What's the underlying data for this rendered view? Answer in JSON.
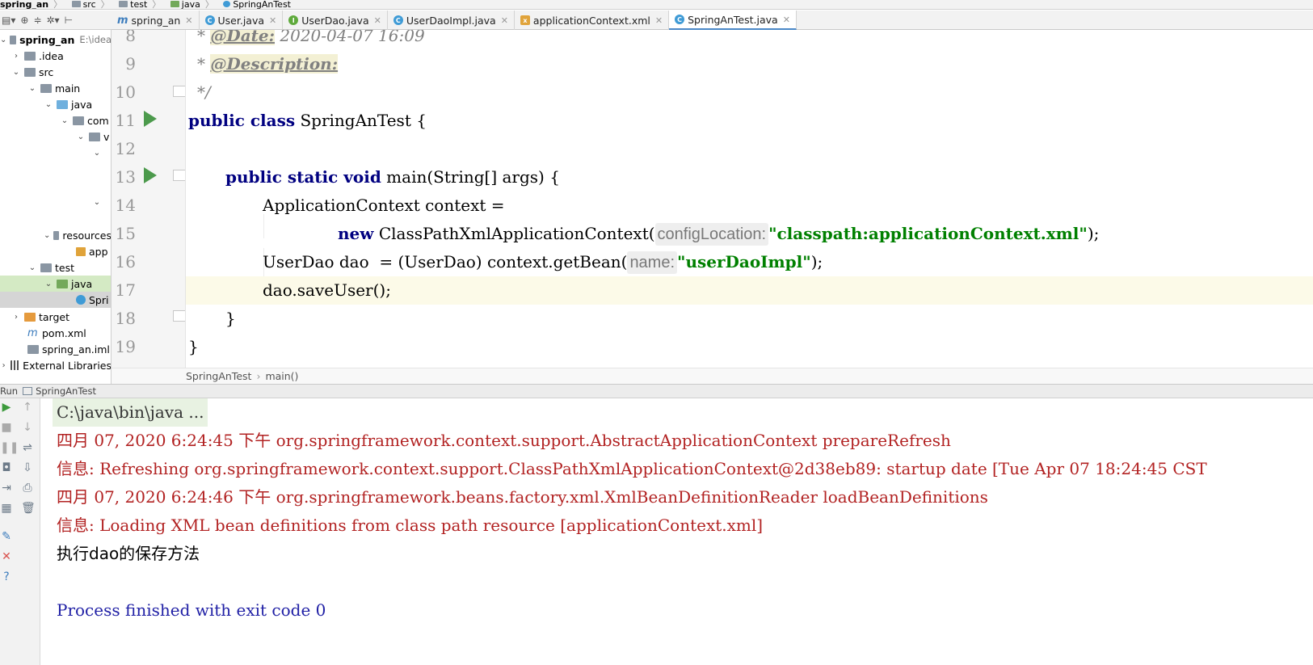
{
  "breadcrumb": [
    "spring_an",
    "src",
    "test",
    "java",
    "SpringAnTest"
  ],
  "tabs": [
    {
      "label": "spring_an",
      "icon": "m"
    },
    {
      "label": "User.java",
      "icon": "c"
    },
    {
      "label": "UserDao.java",
      "icon": "i"
    },
    {
      "label": "UserDaoImpl.java",
      "icon": "c"
    },
    {
      "label": "applicationContext.xml",
      "icon": "x"
    },
    {
      "label": "SpringAnTest.java",
      "icon": "c",
      "active": true
    }
  ],
  "tree": {
    "project": "spring_an",
    "project_path": "E:\\idea",
    "idea": ".idea",
    "src": "src",
    "main": "main",
    "java": "java",
    "com": "com",
    "v": "v",
    "resources": "resources",
    "app": "app",
    "test": "test",
    "test_java": "java",
    "spri": "Spri",
    "target": "target",
    "pom": "pom.xml",
    "iml": "spring_an.iml",
    "libs": "External Libraries"
  },
  "code": {
    "line_numbers": [
      "8",
      "9",
      "10",
      "11",
      "12",
      "13",
      "14",
      "15",
      "16",
      "17",
      "18",
      "19"
    ],
    "l8_prefix": "* ",
    "l8_tag": "@Date:",
    "l8_rest": " 2020-04-07 16:09",
    "l9_prefix": "* ",
    "l9_tag": "@Description:",
    "l10": "*/",
    "l11_kw": "public class",
    "l11_rest": " SpringAnTest {",
    "l13_kw": "public static void",
    "l13_rest": " main(String[] args) {",
    "l14": "ApplicationContext context =",
    "l15_kw": "new",
    "l15_call": " ClassPathXmlApplicationContext(",
    "l15_hint": "configLocation:",
    "l15_str": "\"classpath:applicationContext.xml\"",
    "l15_end": ");",
    "l16_start": "UserDao dao  = (UserDao) context.getBean(",
    "l16_hint": "name:",
    "l16_str": "\"userDaoImpl\"",
    "l16_end": ");",
    "l17": "dao.saveUser();",
    "l18": "}",
    "l19": "}"
  },
  "editor_breadcrumb": [
    "SpringAnTest",
    "main()"
  ],
  "run": {
    "label": "Run",
    "config": "SpringAnTest"
  },
  "console": [
    "C:\\java\\bin\\java ...",
    "四月 07, 2020 6:24:45 下午 org.springframework.context.support.AbstractApplicationContext prepareRefresh",
    "信息: Refreshing org.springframework.context.support.ClassPathXmlApplicationContext@2d38eb89: startup date [Tue Apr 07 18:24:45 CST",
    "四月 07, 2020 6:24:46 下午 org.springframework.beans.factory.xml.XmlBeanDefinitionReader loadBeanDefinitions",
    "信息: Loading XML bean definitions from class path resource [applicationContext.xml]",
    "执行dao的保存方法",
    "Process finished with exit code 0"
  ]
}
